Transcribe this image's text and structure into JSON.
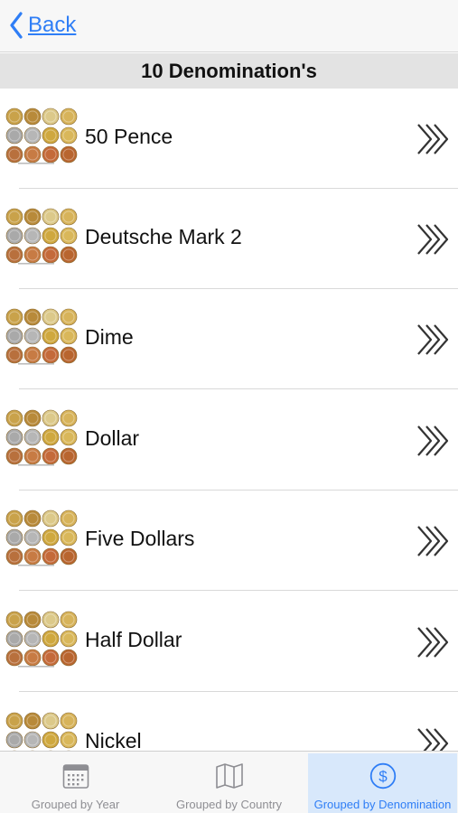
{
  "nav": {
    "back_label": "Back",
    "back_icon": "chevron-left-icon"
  },
  "section": {
    "title": "10 Denomination's"
  },
  "rows": [
    {
      "label": "50 Pence"
    },
    {
      "label": "Deutsche Mark 2"
    },
    {
      "label": "Dime"
    },
    {
      "label": "Dollar"
    },
    {
      "label": "Five Dollars"
    },
    {
      "label": "Half Dollar"
    },
    {
      "label": "Nickel"
    }
  ],
  "row_icons": {
    "thumbnail": "coins-thumbnail",
    "disclosure": "triple-chevron-right-icon"
  },
  "tabs": [
    {
      "label": "Grouped by Year",
      "icon": "calendar-icon",
      "selected": false
    },
    {
      "label": "Grouped by Country",
      "icon": "map-icon",
      "selected": false
    },
    {
      "label": "Grouped by Denomination",
      "icon": "dollar-circle-icon",
      "selected": true
    }
  ],
  "colors": {
    "accent": "#2f7ef6",
    "header_bg": "#e3e3e3",
    "tab_active_bg": "#d8e8fb",
    "tab_inactive": "#8e8e93"
  }
}
